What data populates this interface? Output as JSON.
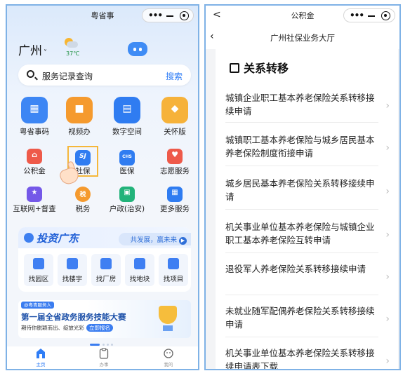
{
  "left": {
    "app_title": "粤省事",
    "city": "广州",
    "temperature": "37℃",
    "search": {
      "placeholder": "服务记录查询",
      "button": "搜索"
    },
    "main_services": [
      "粤省事码",
      "视频办",
      "数字空间",
      "关怀版"
    ],
    "services_row1": [
      "公积金",
      "社保",
      "医保",
      "志愿服务"
    ],
    "services_row2": [
      "互联网+督查",
      "税务",
      "户政(治安)",
      "更多服务"
    ],
    "icon_glyphs": {
      "shebao": "SJ",
      "yibao": "CHS",
      "shuiwu": "税"
    },
    "invest": {
      "title": "投资广东",
      "tag": "共发展，赢未来",
      "items": [
        "找园区",
        "找楼宇",
        "找厂房",
        "找地块",
        "找项目"
      ]
    },
    "banner": {
      "pill": "@粤青服务人",
      "title": "第一届全省政务服务技能大赛",
      "subtitle": "期待你脱颖而出、绽放光彩",
      "action": "立即报名"
    },
    "tabs": [
      "主页",
      "办事",
      "我的"
    ]
  },
  "right": {
    "app_title": "公积金",
    "page_title": "广州社保业务大厅",
    "section_title": "关系转移",
    "items": [
      "城镇企业职工基本养老保险关系转移接续申请",
      "城镇职工基本养老保险与城乡居民基本养老保险制度衔接申请",
      "城乡居民基本养老保险关系转移接续申请",
      "机关事业单位基本养老保险与城镇企业职工基本养老保险互转申请",
      "退役军人养老保险关系转移接续申请",
      "未就业随军配偶养老保险关系转移接续申请",
      "机关事业单位基本养老保险关系转移接续申请表下载"
    ]
  },
  "colors": {
    "accent": "#2f7df6",
    "highlight": "#f5b73a",
    "frame": "#7fb2e6"
  }
}
